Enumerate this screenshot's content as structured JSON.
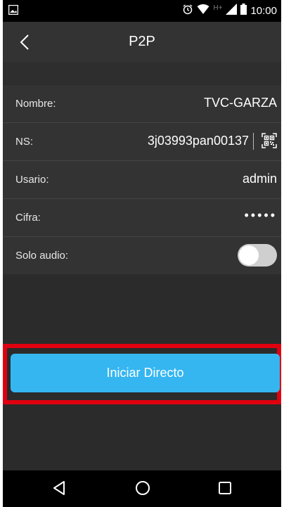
{
  "status_bar": {
    "time": "10:00",
    "network_label": "H+",
    "icons": [
      "image-icon",
      "alarm-icon",
      "wifi-icon",
      "signal-icon",
      "battery-icon"
    ]
  },
  "header": {
    "title": "P2P",
    "back_icon": "chevron-left-icon"
  },
  "form": {
    "name": {
      "label": "Nombre:",
      "value": "TVC-GARZA"
    },
    "ns": {
      "label": "NS:",
      "value": "3j03993pan00137",
      "icon": "qr-code-icon"
    },
    "user": {
      "label": "Usario:",
      "value": "admin"
    },
    "password": {
      "label": "Cifra:",
      "value": "•••••"
    },
    "audio_only": {
      "label": "Solo audio:",
      "enabled": false
    }
  },
  "actions": {
    "start_label": "Iniciar Directo"
  },
  "nav": {
    "icons": [
      "back-triangle-icon",
      "home-circle-icon",
      "recents-square-icon"
    ]
  },
  "colors": {
    "accent": "#35b6f1",
    "highlight": "#e0000f",
    "background": "#2b2b2b",
    "panel": "#333333"
  }
}
